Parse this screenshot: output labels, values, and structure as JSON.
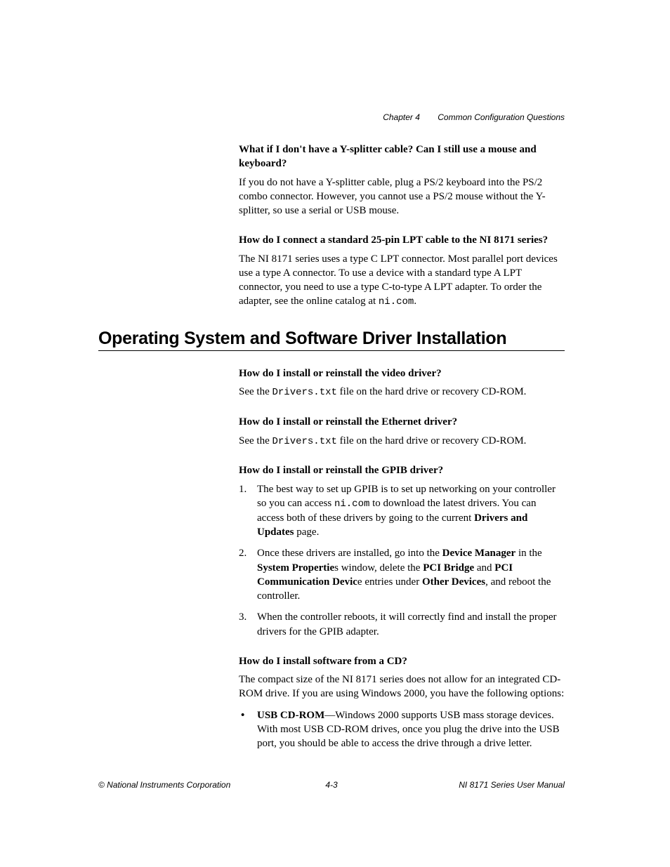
{
  "header": {
    "chapter": "Chapter 4",
    "title": "Common Configuration Questions"
  },
  "qa1": {
    "q": "What if I don't have a Y-splitter cable? Can I still use a mouse and keyboard?",
    "a": "If you do not have a Y-splitter cable, plug a PS/2 keyboard into the PS/2 combo connector. However, you cannot use a PS/2 mouse without the Y-splitter, so use a serial or USB mouse."
  },
  "qa2": {
    "q": "How do I connect a standard 25-pin LPT cable to the NI 8171 series?",
    "a_pre": "The NI 8171 series uses a type C LPT connector. Most parallel port devices use a type A connector. To use a device with a standard type A LPT connector, you need to use a type C-to-type A LPT adapter. To order the adapter, see the online catalog at ",
    "a_code": "ni.com",
    "a_post": "."
  },
  "section_heading": "Operating System and Software Driver Installation",
  "qa3": {
    "q": "How do I install or reinstall the video driver?",
    "a_pre": "See the ",
    "a_code": "Drivers.txt",
    "a_post": " file on the hard drive or recovery CD-ROM."
  },
  "qa4": {
    "q": "How do I install or reinstall the Ethernet driver?",
    "a_pre": "See the ",
    "a_code": "Drivers.txt",
    "a_post": " file on the hard drive or recovery CD-ROM."
  },
  "qa5": {
    "q": "How do I install or reinstall the GPIB driver?",
    "steps": {
      "s1_pre": "The best way to set up GPIB is to set up networking on your controller so you can access ",
      "s1_code": "ni.com",
      "s1_mid": " to download the latest drivers. You can access both of these drivers by going to the current ",
      "s1_b": "Drivers and Updates",
      "s1_post": " page.",
      "s2_pre": "Once these drivers are installed, go into the ",
      "s2_b1": "Device Manager",
      "s2_t1": " in the ",
      "s2_b2": "System Propertie",
      "s2_t2": "s window, delete the ",
      "s2_b3": "PCI Bridge",
      "s2_t3": " and ",
      "s2_b4": "PCI Communication Devic",
      "s2_t4": "e entries under ",
      "s2_b5": "Other Devices",
      "s2_t5": ", and reboot the controller.",
      "s3": "When the controller reboots, it will correctly find and install the proper drivers for the GPIB adapter."
    }
  },
  "qa6": {
    "q": "How do I install software from a CD?",
    "a": "The compact size of the NI 8171 series does not allow for an integrated CD-ROM drive. If you are using Windows 2000, you have the following options:",
    "bullet_b": "USB CD-ROM",
    "bullet_t": "—Windows 2000 supports USB mass storage devices. With most USB CD-ROM drives, once you plug the drive into the USB port, you should be able to access the drive through a drive letter."
  },
  "footer": {
    "left": "© National Instruments Corporation",
    "center": "4-3",
    "right": "NI 8171 Series User Manual"
  }
}
